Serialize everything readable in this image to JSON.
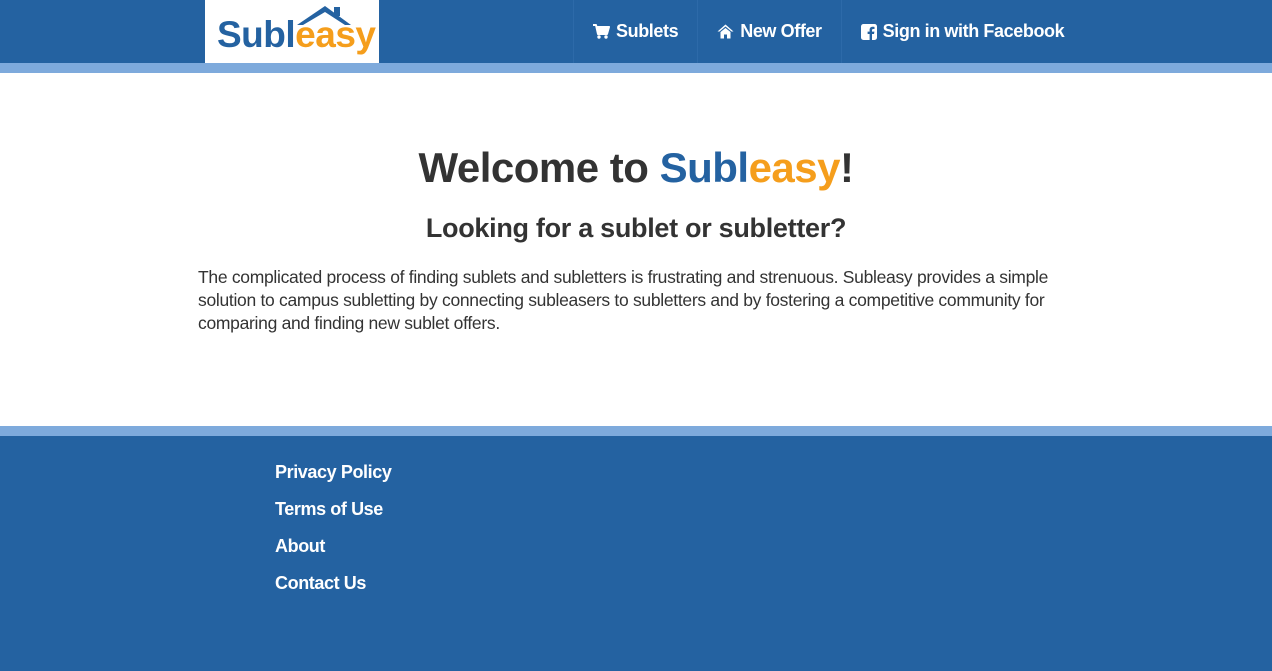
{
  "header": {
    "logo": {
      "sub": "Subl",
      "easy": "easy"
    },
    "nav": [
      {
        "label": "Sublets",
        "icon": "shopping-cart-icon"
      },
      {
        "label": "New Offer",
        "icon": "home-icon"
      },
      {
        "label": "Sign in with Facebook",
        "icon": "facebook-icon"
      }
    ]
  },
  "main": {
    "title": {
      "prefix": "Welcome to ",
      "brand_sub": "Subl",
      "brand_easy": "easy",
      "suffix": "!"
    },
    "subheading": "Looking for a sublet or subletter?",
    "intro": "The complicated process of finding sublets and subletters is frustrating and strenuous. Subleasy provides a simple solution to campus subletting by connecting subleasers to subletters and by fostering a competitive community for comparing and finding new sublet offers."
  },
  "footer": {
    "links": [
      "Privacy Policy",
      "Terms of Use",
      "About",
      "Contact Us"
    ]
  },
  "colors": {
    "primary": "#2462a1",
    "accent_bar": "#7eaadc",
    "brand_orange": "#f59e1c",
    "text": "#333333"
  }
}
